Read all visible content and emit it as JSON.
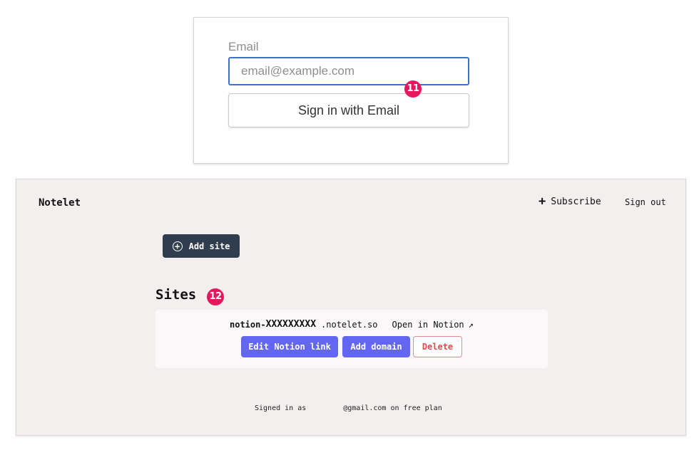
{
  "login": {
    "email_label": "Email",
    "email_placeholder": "email@example.com",
    "email_value": "",
    "signin_button": "Sign in with Email",
    "step_badge": "11"
  },
  "dashboard": {
    "brand": "Notelet",
    "nav": {
      "subscribe_icon": "+",
      "subscribe_label": "Subscribe",
      "signout_label": "Sign out"
    },
    "add_site_icon": "+",
    "add_site_label": "Add site",
    "sites_heading": "Sites",
    "step_badge": "12",
    "site": {
      "prefix": "notion-",
      "masked_id": "XXXXXXXXX",
      "domain_suffix": ".notelet.so",
      "open_label": "Open in Notion",
      "open_icon": "↗",
      "edit_button": "Edit Notion link",
      "domain_button": "Add domain",
      "delete_button": "Delete"
    },
    "footer": {
      "signed_in_prefix": "Signed in as",
      "signed_in_suffix": "@gmail.com on free plan"
    }
  },
  "colors": {
    "badge": "#e6175c",
    "input_focus": "#3f73c9",
    "primary_button": "#6366f1",
    "dark_button": "#2f3d4e",
    "danger": "#e5484d",
    "dashboard_bg": "#f4efef"
  },
  "icons": {
    "subscribe": "plus-icon",
    "add_site": "circle-plus-icon",
    "open_notion": "external-link-arrow-icon"
  }
}
